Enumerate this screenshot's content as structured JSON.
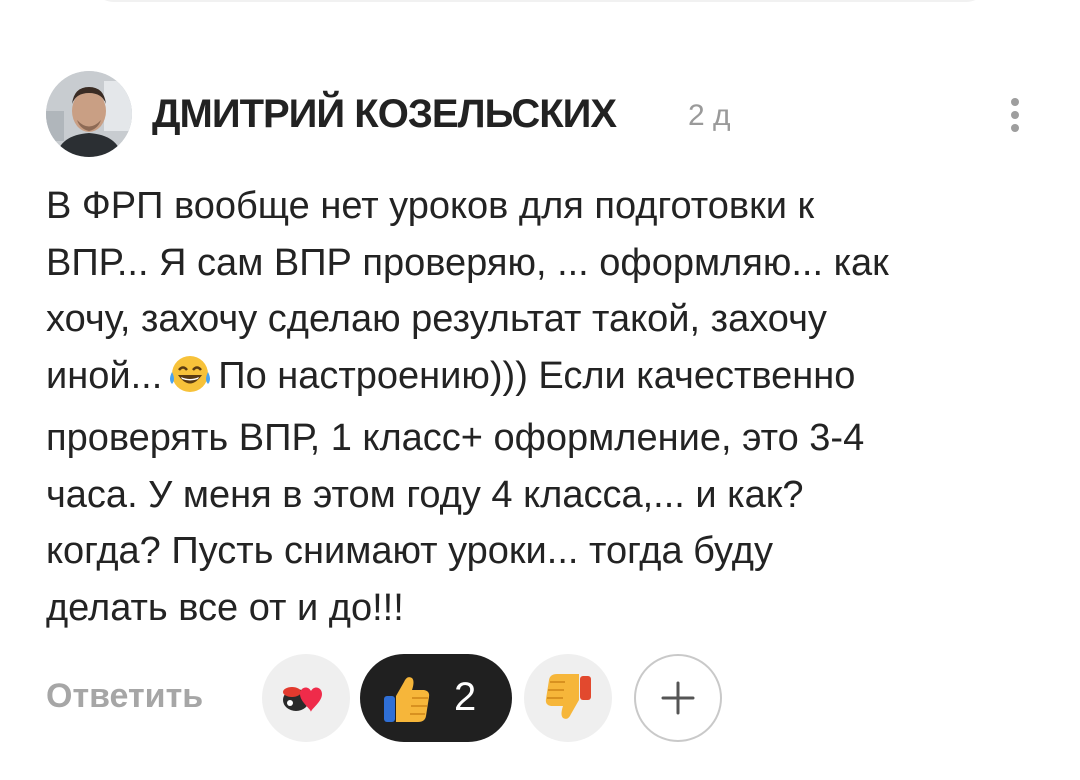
{
  "comment": {
    "author": "ДМИТРИЙ КОЗЕЛЬСКИХ",
    "time": "2 д",
    "text_lines": [
      "В ФРП вообще нет уроков для подготовки к",
      "ВПР... Я сам ВПР проверяю, ... оформляю... как",
      "хочу, захочу сделаю результат такой, захочу",
      "иной...",
      "По настроению))) Если качественно",
      "проверять ВПР, 1 класс+ оформление, это 3-4",
      "часа. У меня в этом году 4 класса,... и как?",
      "когда? Пусть снимают уроки... тогда буду",
      "делать все от и до!!!"
    ],
    "inline_emoji": "laughing-tears-emoji"
  },
  "actions": {
    "reply_label": "Ответить",
    "reactions": [
      {
        "name": "heart-reaction",
        "icon": "heart-sticker-icon"
      },
      {
        "name": "like-reaction",
        "icon": "thumbs-up-icon",
        "count": "2",
        "active": true
      },
      {
        "name": "dislike-reaction",
        "icon": "thumbs-down-icon"
      }
    ],
    "add_reaction_icon": "plus-icon"
  },
  "colors": {
    "active_pill": "#202020",
    "muted_text": "#a6a6a6",
    "reaction_bg": "#efefef"
  }
}
